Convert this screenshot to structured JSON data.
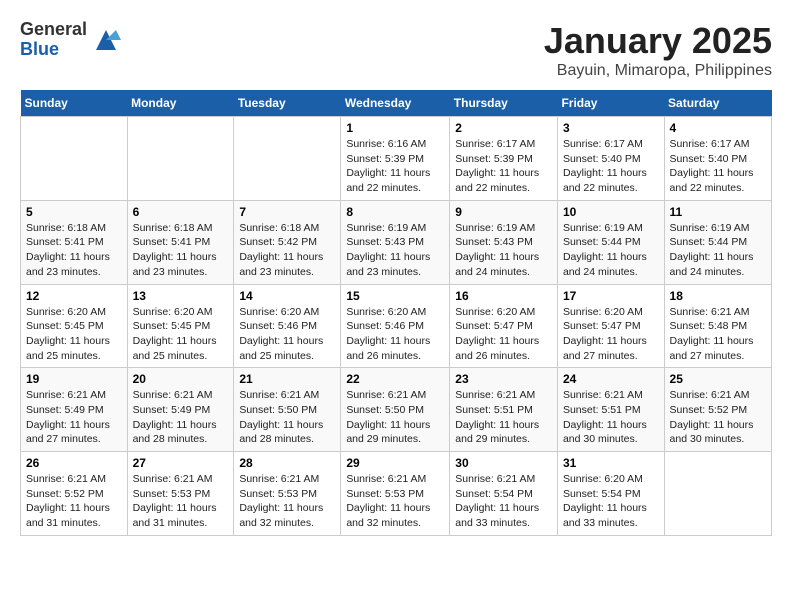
{
  "header": {
    "logo_general": "General",
    "logo_blue": "Blue",
    "month_title": "January 2025",
    "location": "Bayuin, Mimaropa, Philippines"
  },
  "days_of_week": [
    "Sunday",
    "Monday",
    "Tuesday",
    "Wednesday",
    "Thursday",
    "Friday",
    "Saturday"
  ],
  "weeks": [
    [
      {
        "day": "",
        "info": ""
      },
      {
        "day": "",
        "info": ""
      },
      {
        "day": "",
        "info": ""
      },
      {
        "day": "1",
        "info": "Sunrise: 6:16 AM\nSunset: 5:39 PM\nDaylight: 11 hours and 22 minutes."
      },
      {
        "day": "2",
        "info": "Sunrise: 6:17 AM\nSunset: 5:39 PM\nDaylight: 11 hours and 22 minutes."
      },
      {
        "day": "3",
        "info": "Sunrise: 6:17 AM\nSunset: 5:40 PM\nDaylight: 11 hours and 22 minutes."
      },
      {
        "day": "4",
        "info": "Sunrise: 6:17 AM\nSunset: 5:40 PM\nDaylight: 11 hours and 22 minutes."
      }
    ],
    [
      {
        "day": "5",
        "info": "Sunrise: 6:18 AM\nSunset: 5:41 PM\nDaylight: 11 hours and 23 minutes."
      },
      {
        "day": "6",
        "info": "Sunrise: 6:18 AM\nSunset: 5:41 PM\nDaylight: 11 hours and 23 minutes."
      },
      {
        "day": "7",
        "info": "Sunrise: 6:18 AM\nSunset: 5:42 PM\nDaylight: 11 hours and 23 minutes."
      },
      {
        "day": "8",
        "info": "Sunrise: 6:19 AM\nSunset: 5:43 PM\nDaylight: 11 hours and 23 minutes."
      },
      {
        "day": "9",
        "info": "Sunrise: 6:19 AM\nSunset: 5:43 PM\nDaylight: 11 hours and 24 minutes."
      },
      {
        "day": "10",
        "info": "Sunrise: 6:19 AM\nSunset: 5:44 PM\nDaylight: 11 hours and 24 minutes."
      },
      {
        "day": "11",
        "info": "Sunrise: 6:19 AM\nSunset: 5:44 PM\nDaylight: 11 hours and 24 minutes."
      }
    ],
    [
      {
        "day": "12",
        "info": "Sunrise: 6:20 AM\nSunset: 5:45 PM\nDaylight: 11 hours and 25 minutes."
      },
      {
        "day": "13",
        "info": "Sunrise: 6:20 AM\nSunset: 5:45 PM\nDaylight: 11 hours and 25 minutes."
      },
      {
        "day": "14",
        "info": "Sunrise: 6:20 AM\nSunset: 5:46 PM\nDaylight: 11 hours and 25 minutes."
      },
      {
        "day": "15",
        "info": "Sunrise: 6:20 AM\nSunset: 5:46 PM\nDaylight: 11 hours and 26 minutes."
      },
      {
        "day": "16",
        "info": "Sunrise: 6:20 AM\nSunset: 5:47 PM\nDaylight: 11 hours and 26 minutes."
      },
      {
        "day": "17",
        "info": "Sunrise: 6:20 AM\nSunset: 5:47 PM\nDaylight: 11 hours and 27 minutes."
      },
      {
        "day": "18",
        "info": "Sunrise: 6:21 AM\nSunset: 5:48 PM\nDaylight: 11 hours and 27 minutes."
      }
    ],
    [
      {
        "day": "19",
        "info": "Sunrise: 6:21 AM\nSunset: 5:49 PM\nDaylight: 11 hours and 27 minutes."
      },
      {
        "day": "20",
        "info": "Sunrise: 6:21 AM\nSunset: 5:49 PM\nDaylight: 11 hours and 28 minutes."
      },
      {
        "day": "21",
        "info": "Sunrise: 6:21 AM\nSunset: 5:50 PM\nDaylight: 11 hours and 28 minutes."
      },
      {
        "day": "22",
        "info": "Sunrise: 6:21 AM\nSunset: 5:50 PM\nDaylight: 11 hours and 29 minutes."
      },
      {
        "day": "23",
        "info": "Sunrise: 6:21 AM\nSunset: 5:51 PM\nDaylight: 11 hours and 29 minutes."
      },
      {
        "day": "24",
        "info": "Sunrise: 6:21 AM\nSunset: 5:51 PM\nDaylight: 11 hours and 30 minutes."
      },
      {
        "day": "25",
        "info": "Sunrise: 6:21 AM\nSunset: 5:52 PM\nDaylight: 11 hours and 30 minutes."
      }
    ],
    [
      {
        "day": "26",
        "info": "Sunrise: 6:21 AM\nSunset: 5:52 PM\nDaylight: 11 hours and 31 minutes."
      },
      {
        "day": "27",
        "info": "Sunrise: 6:21 AM\nSunset: 5:53 PM\nDaylight: 11 hours and 31 minutes."
      },
      {
        "day": "28",
        "info": "Sunrise: 6:21 AM\nSunset: 5:53 PM\nDaylight: 11 hours and 32 minutes."
      },
      {
        "day": "29",
        "info": "Sunrise: 6:21 AM\nSunset: 5:53 PM\nDaylight: 11 hours and 32 minutes."
      },
      {
        "day": "30",
        "info": "Sunrise: 6:21 AM\nSunset: 5:54 PM\nDaylight: 11 hours and 33 minutes."
      },
      {
        "day": "31",
        "info": "Sunrise: 6:20 AM\nSunset: 5:54 PM\nDaylight: 11 hours and 33 minutes."
      },
      {
        "day": "",
        "info": ""
      }
    ]
  ]
}
